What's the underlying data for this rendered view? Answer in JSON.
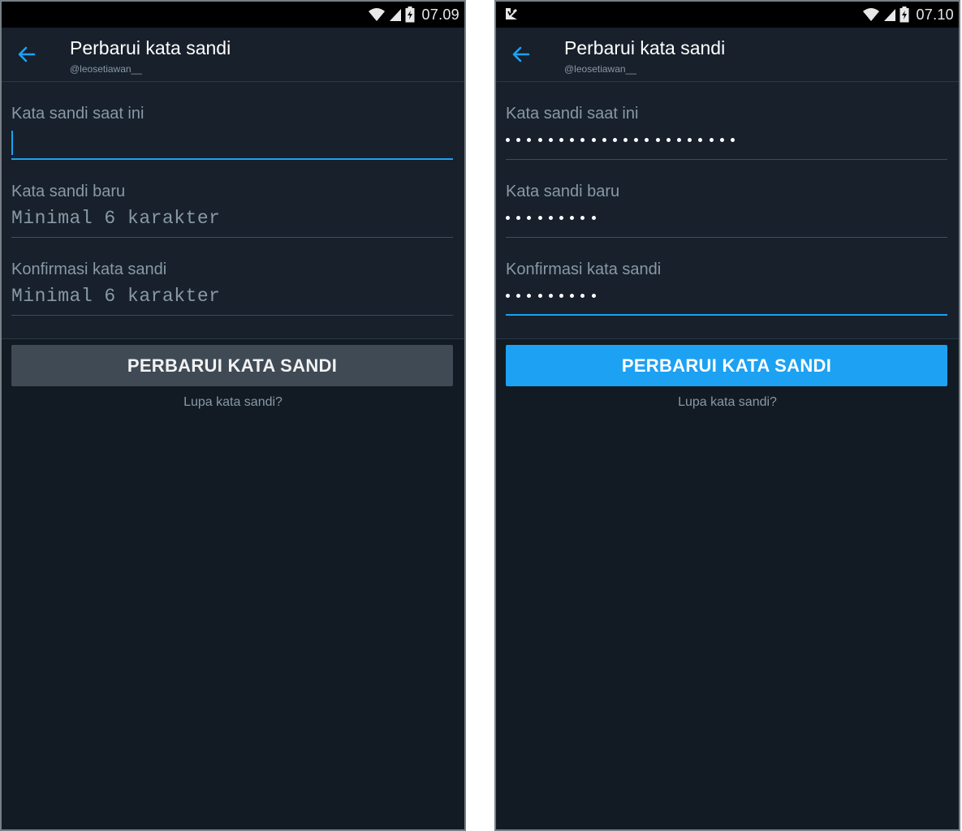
{
  "colors": {
    "background": "#121a23",
    "surface": "#17202b",
    "accent": "#1da1f2",
    "label": "#8899a6",
    "button_disabled": "#3f4a55"
  },
  "left": {
    "status": {
      "time": "07.09"
    },
    "appbar": {
      "title": "Perbarui kata sandi",
      "username": "@leosetiawan__"
    },
    "fields": [
      {
        "label": "Kata sandi saat ini",
        "value": "",
        "placeholder": ""
      },
      {
        "label": "Kata sandi baru",
        "value": "",
        "placeholder": "Minimal 6 karakter"
      },
      {
        "label": "Konfirmasi kata sandi",
        "value": "",
        "placeholder": "Minimal 6 karakter"
      }
    ],
    "submit_label": "PERBARUI KATA SANDI",
    "forgot_link": "Lupa kata sandi?"
  },
  "right": {
    "status": {
      "time": "07.10"
    },
    "appbar": {
      "title": "Perbarui kata sandi",
      "username": "@leosetiawan__"
    },
    "fields": [
      {
        "label": "Kata sandi saat ini",
        "masked_length": 22
      },
      {
        "label": "Kata sandi baru",
        "masked_length": 9
      },
      {
        "label": "Konfirmasi kata sandi",
        "masked_length": 9
      }
    ],
    "submit_label": "PERBARUI KATA SANDI",
    "forgot_link": "Lupa kata sandi?"
  },
  "icons": {
    "back": "back-arrow-icon",
    "wifi": "wifi-icon",
    "signal": "signal-icon",
    "battery": "battery-charging-icon",
    "notification": "notification-app-icon"
  }
}
